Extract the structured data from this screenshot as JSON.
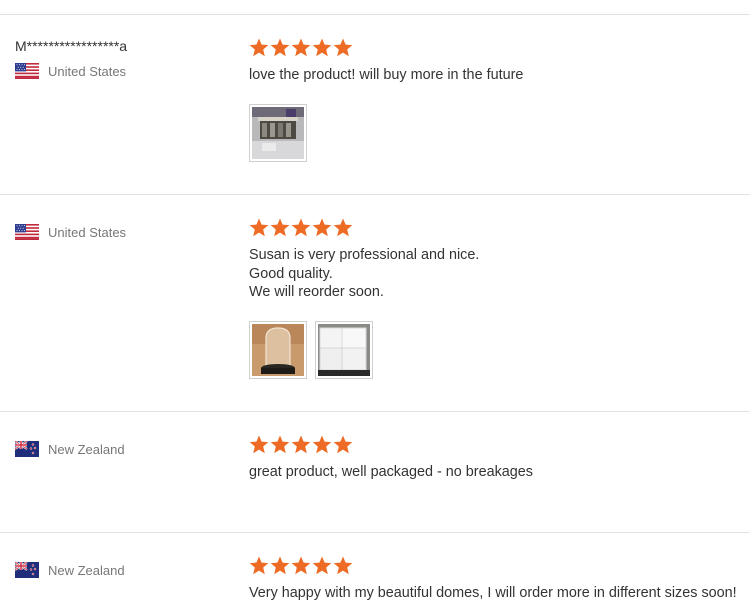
{
  "colors": {
    "star": "#ee6b25",
    "divider": "#e2e2e2",
    "country_text": "#777777"
  },
  "reviews": [
    {
      "buyer_name": "M*****************a",
      "country": "United States",
      "flag_icon": "us-flag-icon",
      "rating": 5,
      "lines": [
        "love the product! will buy more in the future"
      ],
      "photos": [
        "review-photo-shelf"
      ]
    },
    {
      "buyer_name": "",
      "country": "United States",
      "flag_icon": "us-flag-icon",
      "rating": 5,
      "lines": [
        "Susan is very professional and nice.",
        "Good quality.",
        "We will reorder soon."
      ],
      "photos": [
        "review-photo-dome",
        "review-photo-boxes"
      ]
    },
    {
      "buyer_name": "",
      "country": "New Zealand",
      "flag_icon": "nz-flag-icon",
      "rating": 5,
      "lines": [
        "great product, well packaged - no breakages"
      ],
      "photos": []
    },
    {
      "buyer_name": "",
      "country": "New Zealand",
      "flag_icon": "nz-flag-icon",
      "rating": 5,
      "lines": [
        "Very happy with my beautiful domes, I will order more in different sizes soon!"
      ],
      "photos": []
    }
  ]
}
